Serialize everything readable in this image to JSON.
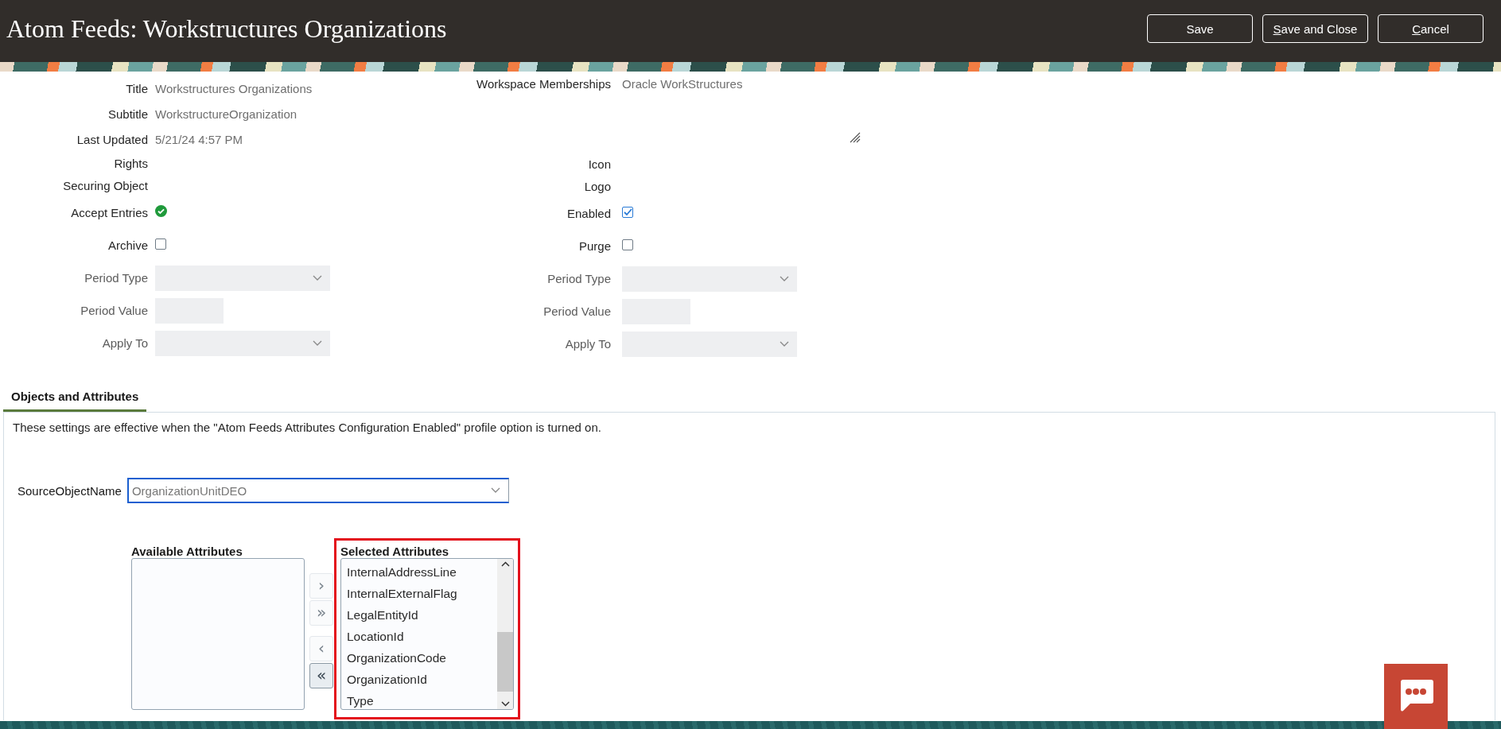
{
  "header": {
    "title": "Atom Feeds: Workstructures Organizations",
    "buttons": [
      {
        "label": "Save",
        "mnemonic": false
      },
      {
        "label": "Save and Close",
        "mnemonic": true
      },
      {
        "label": "Cancel",
        "mnemonic": true
      }
    ]
  },
  "form": {
    "left_fields": [
      {
        "label": "Title",
        "kind": "text",
        "value": "Workstructures Organizations"
      },
      {
        "label": "Subtitle",
        "kind": "text",
        "value": "WorkstructureOrganization"
      },
      {
        "label": "Last Updated",
        "kind": "text",
        "value": "5/21/24 4:57 PM"
      },
      {
        "label": "Rights",
        "kind": "label_only"
      },
      {
        "label": "Securing Object",
        "kind": "label_only"
      },
      {
        "label": "Accept Entries",
        "kind": "status",
        "checked": true
      },
      {
        "label": "Archive",
        "kind": "checkbox",
        "checked": false
      },
      {
        "label": "Period Type",
        "kind": "select",
        "disabled": true
      },
      {
        "label": "Period Value",
        "kind": "input",
        "disabled": true
      },
      {
        "label": "Apply To",
        "kind": "select",
        "disabled": true
      }
    ],
    "right_fields": [
      {
        "label": "Workspace Memberships",
        "kind": "textarea",
        "value": "Oracle WorkStructures"
      },
      {
        "label": "Icon",
        "kind": "label_only"
      },
      {
        "label": "Logo",
        "kind": "label_only"
      },
      {
        "label": "Enabled",
        "kind": "checkbox",
        "checked": true
      },
      {
        "label": "Purge",
        "kind": "checkbox",
        "checked": false
      },
      {
        "label": "Period Type",
        "kind": "select",
        "disabled": true
      },
      {
        "label": "Period Value",
        "kind": "input",
        "disabled": true
      },
      {
        "label": "Apply To",
        "kind": "select",
        "disabled": true
      }
    ]
  },
  "tabs": [
    {
      "label": "Objects and Attributes",
      "selected": true
    }
  ],
  "objects_panel": {
    "note": "These settings are effective when the \"Atom Feeds Attributes Configuration Enabled\" profile option is turned on.",
    "source_object": {
      "label": "SourceObjectName",
      "value": "OrganizationUnitDEO",
      "focused": true
    },
    "available_attributes": {
      "label": "Available Attributes"
    },
    "shuttle_buttons": [
      {
        "symbol": "›",
        "disabled": true
      },
      {
        "symbol": "»",
        "disabled": true
      },
      {
        "symbol": "‹",
        "disabled": true
      },
      {
        "symbol": "«",
        "disabled": false
      }
    ],
    "selected_attributes": {
      "label": "Selected Attributes",
      "highlighted": true,
      "items": [
        "InternalAddressLine",
        "InternalExternalFlag",
        "LegalEntityId",
        "LocationId",
        "OrganizationCode",
        "OrganizationId",
        "Type"
      ]
    }
  }
}
